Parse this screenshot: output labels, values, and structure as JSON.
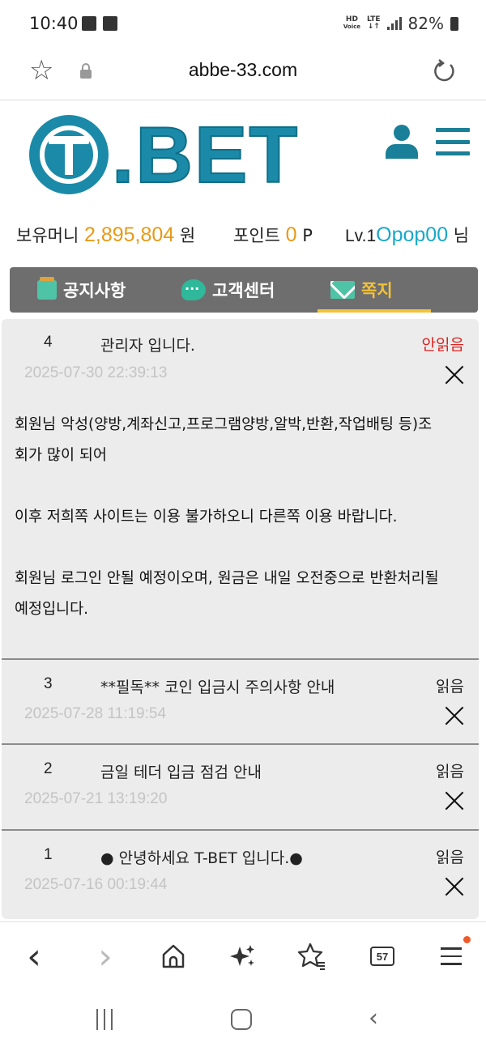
{
  "status_bar": {
    "time": "10:40",
    "network_top": "HD",
    "network_bottom": "Voice",
    "lte_top": "LTE",
    "lte_bottom": "↓↑",
    "battery": "82%"
  },
  "browser": {
    "url": "abbe-33.com",
    "icons": [
      "star-outline-icon",
      "lock-icon",
      "reload-icon"
    ]
  },
  "header": {
    "logo_text": ".BET",
    "brand_color": "#1a8aa8",
    "icons": [
      "user-icon",
      "hamburger-menu-icon"
    ]
  },
  "account": {
    "money_label": "보유머니",
    "money_value": "2,895,804",
    "money_unit": "원",
    "point_label": "포인트",
    "point_value": "0",
    "point_unit": "P",
    "level_prefix": "Lv.1",
    "username": "Opop00",
    "honorific": "님"
  },
  "tabs": [
    {
      "label": "공지사항",
      "icon": "notice-icon",
      "active": false
    },
    {
      "label": "고객센터",
      "icon": "chat-icon",
      "active": false
    },
    {
      "label": "쪽지",
      "icon": "mail-icon",
      "active": true
    }
  ],
  "messages": [
    {
      "num": "4",
      "title": "관리자 입니다.",
      "status": "안읽음",
      "date": "2025-07-30 22:39:13",
      "expanded": true,
      "body": [
        "회원님 악성(양방,계좌신고,프로그램양방,알박,반환,작업배팅 등)조",
        "회가 많이 되어",
        "",
        "이후 저희쪽 사이트는 이용 불가하오니 다른쪽 이용 바랍니다.",
        "",
        "회원님 로그인 안될 예정이오며, 원금은 내일 오전중으로 반환처리될",
        "예정입니다."
      ]
    },
    {
      "num": "3",
      "title": "**필독** 코인 입금시 주의사항 안내",
      "status": "읽음",
      "date": "2025-07-28 11:19:54",
      "expanded": false
    },
    {
      "num": "2",
      "title": "금일 테더 입금 점검 안내",
      "status": "읽음",
      "date": "2025-07-21 13:19:20",
      "expanded": false
    },
    {
      "num": "1",
      "title": "● 안녕하세요 T-BET 입니다.●",
      "status": "읽음",
      "date": "2025-07-16 00:19:44",
      "expanded": false
    }
  ],
  "toolbar": {
    "back_glyph": "‹",
    "forward_glyph": "›",
    "tab_count": "57",
    "icons": [
      "back-icon",
      "forward-icon",
      "home-icon",
      "sparkle-icon",
      "bookmarks-icon",
      "tabs-icon",
      "menu-icon"
    ]
  },
  "colors": {
    "unread": "#d9221f",
    "money": "#e79a19",
    "username": "#18a9c9",
    "active_tab": "#f2c23a"
  }
}
